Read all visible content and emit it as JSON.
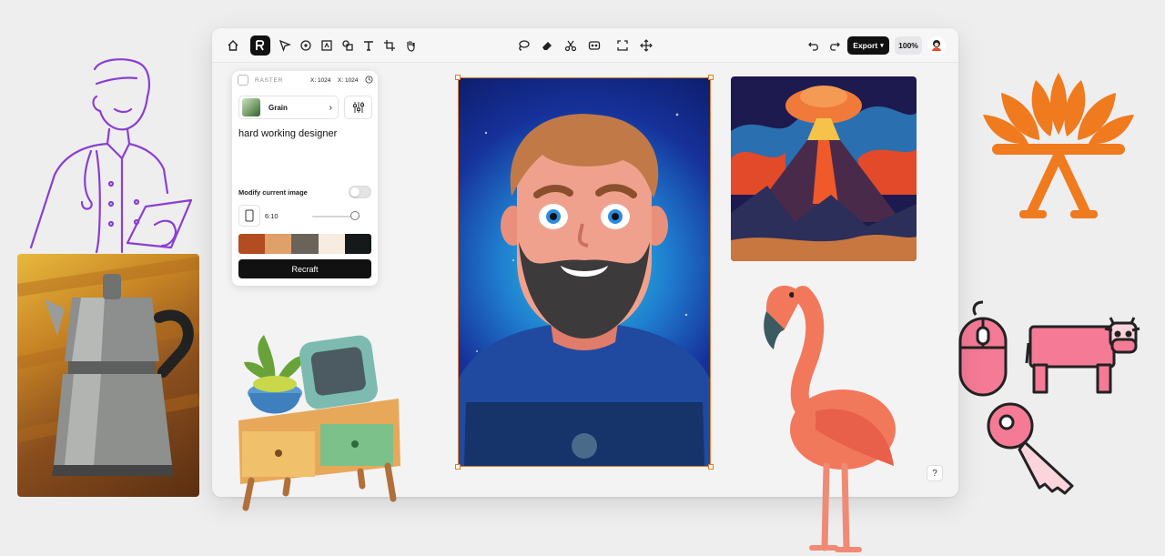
{
  "app": {
    "toolbar": {
      "tools_left": [
        "home-icon",
        "logo-menu-icon",
        "select-icon",
        "circle-select-icon",
        "frame-icon",
        "vector-icon",
        "text-icon",
        "crop-icon",
        "hand-icon"
      ],
      "tools_center": [
        "lasso-icon",
        "eraser-icon",
        "scissors-icon",
        "magic-icon",
        "upscale-icon",
        "move-icon"
      ],
      "undo": "undo-icon",
      "redo": "redo-icon",
      "export_label": "Export",
      "zoom_label": "100%"
    },
    "panel": {
      "mode_label": "RASTER",
      "width_label": "X: 1024",
      "height_label": "X: 1024",
      "style_name": "Grain",
      "prompt": "hard working designer",
      "modify_label": "Modify current image",
      "ratio": "6:10",
      "ratio_level": 0.85,
      "palette": [
        "#b24d21",
        "#e0a06a",
        "#6b625a",
        "#f7ece0",
        "#16191a"
      ],
      "action_label": "Recraft"
    },
    "help_label": "?"
  },
  "colors": {
    "accent": "#e07a2a",
    "logo": "#f07a1e",
    "outline_purple": "#8a3fd1",
    "pink": "#f47a95"
  }
}
